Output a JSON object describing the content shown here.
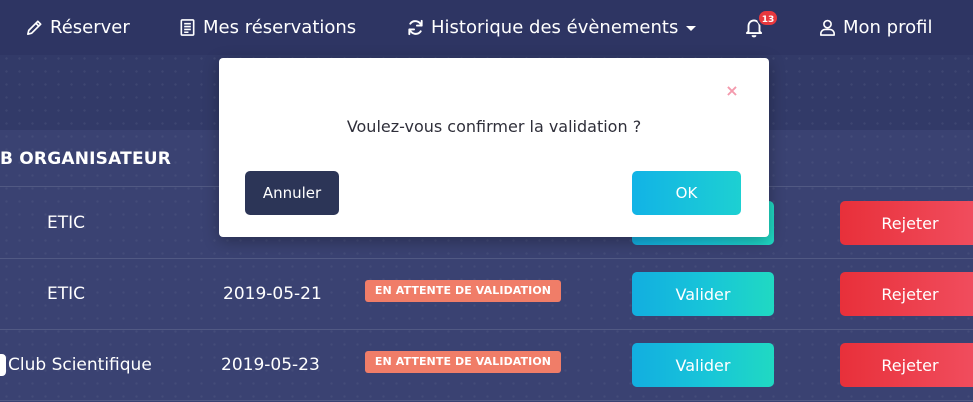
{
  "nav": {
    "reserver": "Réserver",
    "mes_reservations": "Mes réservations",
    "historique": "Historique des évènements",
    "notifications_count": "13",
    "mon_profil": "Mon profil"
  },
  "icons": {
    "reserver": "pencil-icon",
    "mes_reservations": "document-icon",
    "historique": "refresh-icon",
    "notifications": "bell-icon",
    "mon_profil": "user-icon"
  },
  "table": {
    "header_club": "B ORGANISATEUR",
    "rows": [
      {
        "club": "ETIC",
        "date": "",
        "status": "",
        "valider": "",
        "rejeter": "Rejeter"
      },
      {
        "club": "ETIC",
        "date": "2019-05-21",
        "status": "EN ATTENTE DE VALIDATION",
        "valider": "Valider",
        "rejeter": "Rejeter"
      },
      {
        "club": "Club Scientifique",
        "date": "2019-05-23",
        "status": "EN ATTENTE DE VALIDATION",
        "valider": "Valider",
        "rejeter": "Rejeter"
      }
    ]
  },
  "modal": {
    "close": "×",
    "message": "Voulez-vous confirmer la validation ?",
    "cancel": "Annuler",
    "ok": "OK"
  },
  "colors": {
    "background": "#323a68",
    "navbar": "#2e3563",
    "status_badge": "#f07d68",
    "validate_gradient": [
      "#12aee0",
      "#20d9c2"
    ],
    "reject_gradient": [
      "#e8303a",
      "#f14e5f"
    ],
    "cancel_button": "#2c3557",
    "notification_badge": "#e8383e"
  }
}
